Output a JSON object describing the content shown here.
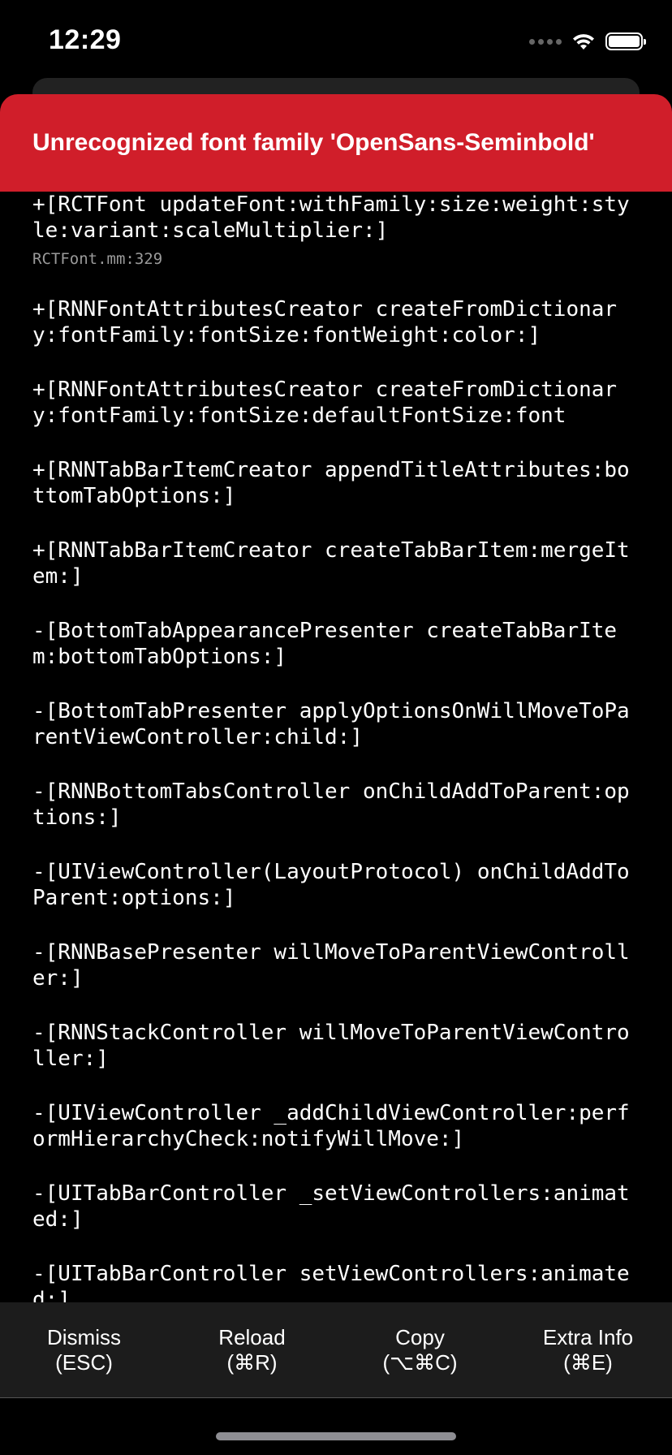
{
  "status_bar": {
    "time": "12:29"
  },
  "banner": {
    "title": "Unrecognized font family 'OpenSans-Seminbold'"
  },
  "frames": [
    {
      "method": "+[RCTFont updateFont:withFamily:size:weight:style:variant:scaleMultiplier:]",
      "file": "RCTFont.mm:329"
    },
    {
      "method": "+[RNNFontAttributesCreator createFromDictionary:fontFamily:fontSize:fontWeight:color:]",
      "file": ""
    },
    {
      "method": "+[RNNFontAttributesCreator createFromDictionary:fontFamily:fontSize:defaultFontSize:font",
      "file": ""
    },
    {
      "method": "+[RNNTabBarItemCreator appendTitleAttributes:bottomTabOptions:]",
      "file": ""
    },
    {
      "method": "+[RNNTabBarItemCreator createTabBarItem:mergeItem:]",
      "file": ""
    },
    {
      "method": "-[BottomTabAppearancePresenter createTabBarItem:bottomTabOptions:]",
      "file": ""
    },
    {
      "method": "-[BottomTabPresenter applyOptionsOnWillMoveToParentViewController:child:]",
      "file": ""
    },
    {
      "method": "-[RNNBottomTabsController onChildAddToParent:options:]",
      "file": ""
    },
    {
      "method": "-[UIViewController(LayoutProtocol) onChildAddToParent:options:]",
      "file": ""
    },
    {
      "method": "-[RNNBasePresenter willMoveToParentViewController:]",
      "file": ""
    },
    {
      "method": "-[RNNStackController willMoveToParentViewController:]",
      "file": ""
    },
    {
      "method": "-[UIViewController _addChildViewController:performHierarchyCheck:notifyWillMove:]",
      "file": ""
    },
    {
      "method": "-[UITabBarController _setViewControllers:animated:]",
      "file": ""
    },
    {
      "method": "-[UITabBarController setViewControllers:animated:]",
      "file": ""
    }
  ],
  "footer": {
    "buttons": [
      {
        "label": "Dismiss",
        "shortcut": "(ESC)"
      },
      {
        "label": "Reload",
        "shortcut": "(⌘R)"
      },
      {
        "label": "Copy",
        "shortcut": "(⌥⌘C)"
      },
      {
        "label": "Extra Info",
        "shortcut": "(⌘E)"
      }
    ]
  },
  "colors": {
    "banner": "#d01e2a",
    "background": "#000000",
    "footer": "#1c1c1c"
  }
}
